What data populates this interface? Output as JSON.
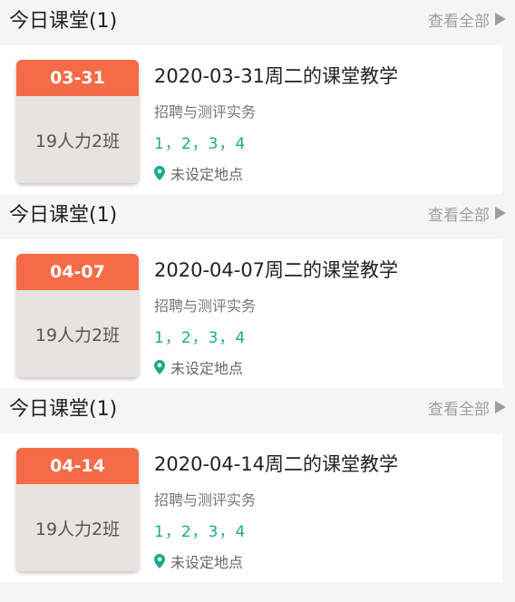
{
  "sections": [
    {
      "header": {
        "title": "今日课堂(1)",
        "view_all": "查看全部"
      },
      "card": {
        "date": "03-31",
        "class_name": "19人力2班",
        "title": "2020-03-31周二的课堂教学",
        "course": "招聘与测评实务",
        "periods": "1，2，3，4",
        "location": "未设定地点"
      }
    },
    {
      "header": {
        "title": "今日课堂(1)",
        "view_all": "查看全部"
      },
      "card": {
        "date": "04-07",
        "class_name": "19人力2班",
        "title": "2020-04-07周二的课堂教学",
        "course": "招聘与测评实务",
        "periods": "1，2，3，4",
        "location": "未设定地点"
      }
    },
    {
      "header": {
        "title": "今日课堂(1)",
        "view_all": "查看全部"
      },
      "card": {
        "date": "04-14",
        "class_name": "19人力2班",
        "title": "2020-04-14周二的课堂教学",
        "course": "招聘与测评实务",
        "periods": "1，2，3，4",
        "location": "未设定地点"
      }
    }
  ],
  "colors": {
    "date_header": "#f46c47",
    "date_body": "#e8e3e0",
    "periods_text": "#1aaa8c",
    "pin_icon": "#1aaa8c",
    "view_all_text": "#9e9e9e"
  },
  "icons": {
    "arrow": "play-arrow-icon",
    "location": "map-pin-icon"
  }
}
